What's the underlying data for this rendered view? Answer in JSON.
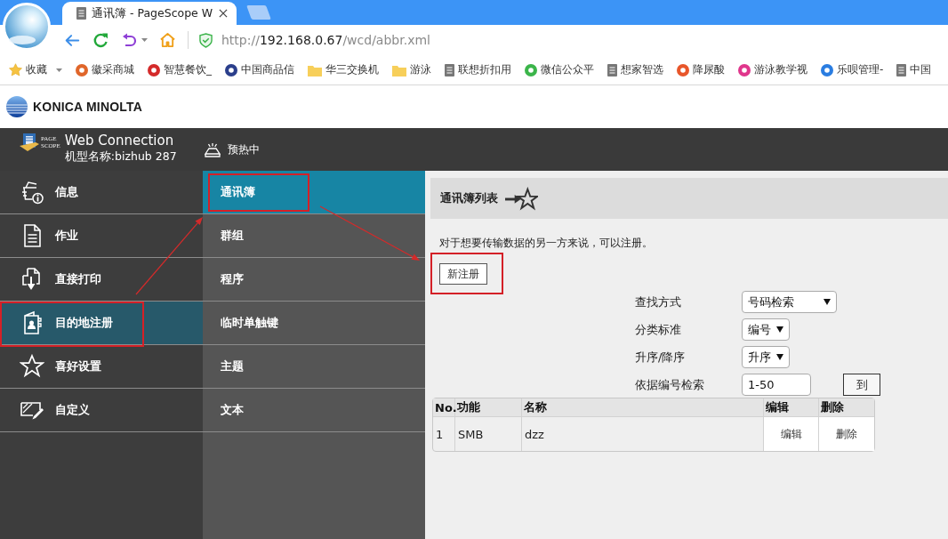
{
  "browser": {
    "tabs": [
      {
        "title": "通讯簿 - PageScope W",
        "selected": true
      }
    ],
    "url": {
      "scheme": "http://",
      "host": "192.168.0.67",
      "path": "/wcd/abbr.xml"
    },
    "bookmarks": [
      {
        "label": "收藏",
        "kind": "favorites"
      },
      {
        "label": "徽采商城",
        "kind": "site",
        "color": "#e0662a"
      },
      {
        "label": "智慧餐饮_",
        "kind": "site",
        "color": "#d42a2a"
      },
      {
        "label": "中国商品信",
        "kind": "site",
        "color": "#2b3f8c"
      },
      {
        "label": "华三交换机",
        "kind": "folder"
      },
      {
        "label": "游泳",
        "kind": "folder"
      },
      {
        "label": "联想折扣用",
        "kind": "page"
      },
      {
        "label": "微信公众平",
        "kind": "site",
        "color": "#3bb54a"
      },
      {
        "label": "想家智选",
        "kind": "page"
      },
      {
        "label": "降尿酸",
        "kind": "site",
        "color": "#e8562a"
      },
      {
        "label": "游泳教学视",
        "kind": "site",
        "color": "#e0368c"
      },
      {
        "label": "乐呗管理-",
        "kind": "site",
        "color": "#2a7de1"
      },
      {
        "label": "中国",
        "kind": "page"
      }
    ]
  },
  "brand": {
    "name": "KONICA MINOLTA"
  },
  "header": {
    "logo_text": [
      "PAGE",
      "SCOPE"
    ],
    "product": "Web Connection",
    "model": "机型名称:bizhub 287",
    "status": "预热中"
  },
  "main_menu": [
    {
      "label": "信息",
      "kind": "info",
      "selected": false,
      "highlighted": false
    },
    {
      "label": "作业",
      "kind": "job",
      "selected": false,
      "highlighted": false
    },
    {
      "label": "直接打印",
      "kind": "print",
      "selected": false,
      "highlighted": false
    },
    {
      "label": "目的地注册",
      "kind": "address",
      "selected": true,
      "highlighted": true
    },
    {
      "label": "喜好设置",
      "kind": "favorites",
      "selected": false,
      "highlighted": false
    },
    {
      "label": "自定义",
      "kind": "customize",
      "selected": false,
      "highlighted": false
    }
  ],
  "sub_menu": [
    {
      "label": "通讯簿",
      "selected": true,
      "highlighted": true
    },
    {
      "label": "群组",
      "selected": false,
      "highlighted": false
    },
    {
      "label": "程序",
      "selected": false,
      "highlighted": false
    },
    {
      "label": "临时单触键",
      "selected": false,
      "highlighted": false
    },
    {
      "label": "主题",
      "selected": false,
      "highlighted": false
    },
    {
      "label": "文本",
      "selected": false,
      "highlighted": false
    }
  ],
  "content": {
    "title": "通讯簿列表",
    "description": "对于想要传输数据的另一方来说，可以注册。",
    "new_button": {
      "label": "新注册",
      "highlighted": true
    },
    "filters": [
      {
        "label": "查找方式",
        "kind": "select",
        "value": "号码检索"
      },
      {
        "label": "分类标准",
        "kind": "select",
        "value": "编号"
      },
      {
        "label": "升序/降序",
        "kind": "select",
        "value": "升序"
      },
      {
        "label": "依据编号检索",
        "kind": "input",
        "value": "1-50",
        "button": "到"
      }
    ],
    "table": {
      "columns": [
        "No.",
        "功能",
        "名称",
        "编辑",
        "删除"
      ],
      "rows": [
        {
          "cells": [
            "1",
            "SMB",
            "dzz"
          ],
          "actions": [
            "编辑",
            "删除"
          ]
        }
      ]
    }
  }
}
